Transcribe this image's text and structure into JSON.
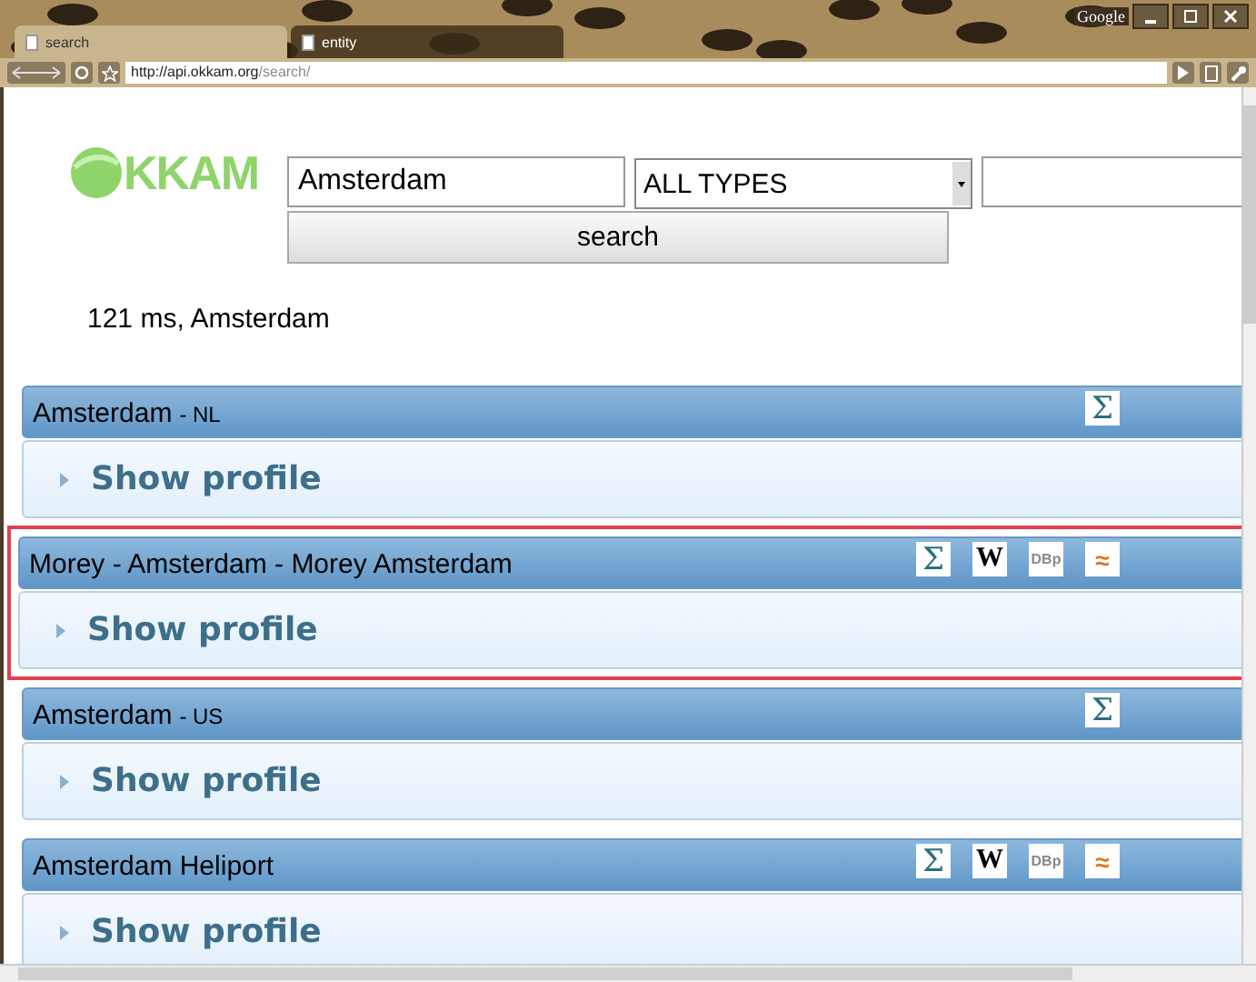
{
  "browser": {
    "tabs": [
      {
        "label": "search",
        "selected": true
      },
      {
        "label": "entity",
        "selected": false
      }
    ],
    "brand": "Google",
    "url": {
      "host": "http://api.okkam.org",
      "path": "/search/"
    }
  },
  "logo": {
    "text": "KKAM"
  },
  "search": {
    "query": "Amsterdam",
    "type": "ALL TYPES",
    "button": "search"
  },
  "status": "121 ms, Amsterdam",
  "results": [
    {
      "name": "Amsterdam",
      "suffix": "- NL",
      "selected": false,
      "sources": [
        {
          "kind": "sigma",
          "label": "Σ"
        }
      ],
      "toggle": "Show profile"
    },
    {
      "name": "Morey - Amsterdam - Morey Amsterdam",
      "selected": true,
      "sources": [
        {
          "kind": "sigma",
          "label": "Σ"
        },
        {
          "kind": "wiki",
          "label": "W"
        },
        {
          "kind": "dbpedia",
          "label": "DBp"
        },
        {
          "kind": "feed",
          "label": "≈"
        }
      ],
      "toggle": "Show profile"
    },
    {
      "name": "Amsterdam",
      "suffix": "- US",
      "selected": false,
      "sources": [
        {
          "kind": "sigma",
          "label": "Σ"
        }
      ],
      "toggle": "Show profile"
    },
    {
      "name": "Amsterdam Heliport",
      "selected": false,
      "sources": [
        {
          "kind": "sigma",
          "label": "Σ"
        },
        {
          "kind": "wiki",
          "label": "W"
        },
        {
          "kind": "dbpedia",
          "label": "DBp"
        },
        {
          "kind": "feed",
          "label": "≈"
        }
      ],
      "toggle": "Show profile"
    }
  ]
}
